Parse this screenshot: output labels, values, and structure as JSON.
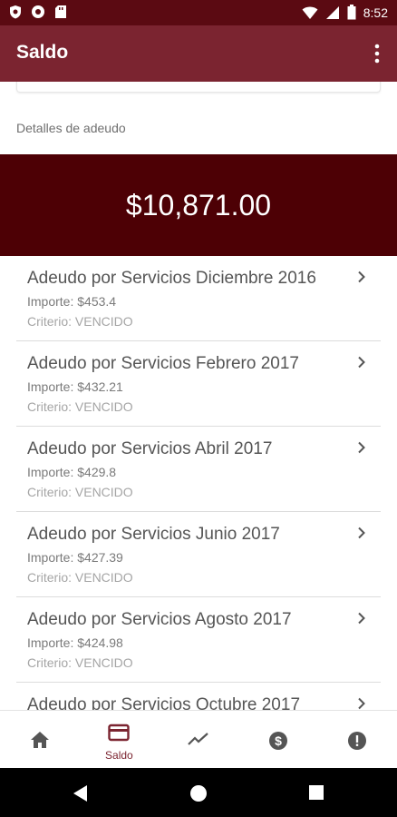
{
  "status_bar": {
    "time": "8:52"
  },
  "app_bar": {
    "title": "Saldo"
  },
  "section_label": "Detalles de adeudo",
  "total": "$10,871.00",
  "debts": [
    {
      "title": "Adeudo por Servicios Diciembre 2016",
      "amount": "Importe: $453.4",
      "status": "Criterio: VENCIDO"
    },
    {
      "title": "Adeudo por Servicios Febrero 2017",
      "amount": "Importe: $432.21",
      "status": "Criterio: VENCIDO"
    },
    {
      "title": "Adeudo por Servicios Abril 2017",
      "amount": "Importe: $429.8",
      "status": "Criterio: VENCIDO"
    },
    {
      "title": "Adeudo por Servicios Junio 2017",
      "amount": "Importe: $427.39",
      "status": "Criterio: VENCIDO"
    },
    {
      "title": "Adeudo por Servicios Agosto 2017",
      "amount": "Importe: $424.98",
      "status": "Criterio: VENCIDO"
    },
    {
      "title": "Adeudo por Servicios Octubre 2017",
      "amount": "",
      "status": ""
    }
  ],
  "bottom_nav": [
    {
      "icon": "home-icon",
      "label": ""
    },
    {
      "icon": "credit-card-icon",
      "label": "Saldo",
      "active": true
    },
    {
      "icon": "trending-line-icon",
      "label": ""
    },
    {
      "icon": "dollar-circle-icon",
      "label": ""
    },
    {
      "icon": "alert-circle-icon",
      "label": ""
    }
  ],
  "colors": {
    "primary": "#7b2430",
    "status_bar": "#5b0a12",
    "banner": "#4d0005"
  }
}
